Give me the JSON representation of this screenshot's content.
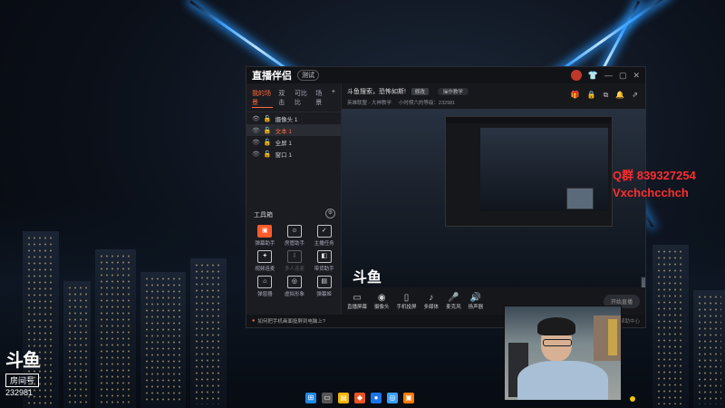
{
  "colors": {
    "accent": "#ff6a3d",
    "beam": "#3aa0ff",
    "overlay_text": "#ff2d2d"
  },
  "wallpaper": {
    "logo_mark": "斗鱼",
    "room_label": "房间号",
    "room_number": "232981"
  },
  "app": {
    "brand": "直播伴侣",
    "badge": "测试",
    "titlebar_icons": [
      "avatar",
      "shirt-icon",
      "minus-icon",
      "square-icon",
      "close-icon"
    ],
    "left_tabs": [
      "我的场景",
      "双击",
      "可比比",
      "场景"
    ],
    "left_tabs_plus": "+",
    "scenes": [
      {
        "name": "摄像头 1",
        "selected": false
      },
      {
        "name": "文本 1",
        "selected": true
      },
      {
        "name": "全屏 1",
        "selected": false
      },
      {
        "name": "窗口 1",
        "selected": false
      }
    ],
    "tools_title": "工具箱",
    "tools": [
      {
        "label": "弹幕助手",
        "glyph": "▣",
        "hot": true
      },
      {
        "label": "房管助手",
        "glyph": "☺",
        "hot": false
      },
      {
        "label": "主播任务",
        "glyph": "✓",
        "hot": false
      },
      {
        "label": "视频连麦",
        "glyph": "✦",
        "hot": false
      },
      {
        "label": "多人连麦",
        "glyph": "⇩",
        "hot": false,
        "dim": true
      },
      {
        "label": "带货助手",
        "glyph": "◧",
        "hot": false
      },
      {
        "label": "弹窗器",
        "glyph": "⌂",
        "hot": false
      },
      {
        "label": "虚拟形象",
        "glyph": "◎",
        "hot": false
      },
      {
        "label": "弹幕姬",
        "glyph": "▤",
        "hot": false
      }
    ],
    "room_title": "斗鱼搜索，恐怖如斯!",
    "edit_chip": "修改",
    "category_chip": "操作教学",
    "info_row2": [
      "英雄联盟 - 大神教学",
      "小时榜六的等级：232981"
    ],
    "bottom_buttons": [
      {
        "label": "直播屏幕",
        "glyph": "▭"
      },
      {
        "label": "摄像头",
        "glyph": "◉"
      },
      {
        "label": "手机投屏",
        "glyph": "▯"
      },
      {
        "label": "多媒体",
        "glyph": "♪"
      },
      {
        "label": "麦克风",
        "glyph": "🎤",
        "mic": true
      },
      {
        "label": "扬声器",
        "glyph": "🔊"
      }
    ],
    "start_button": "开始直播",
    "status_text": "如何把手机画面投屏到电脑上?",
    "status_right": "帮助中心"
  },
  "overlay": {
    "qq_line": "Q群 839327254",
    "wechat_line": "Vxchchcchch"
  },
  "taskbar_icons": [
    "windows-icon",
    "taskview-icon",
    "folder-icon",
    "app1-icon",
    "app2-icon",
    "browser-icon",
    "douyu-icon"
  ]
}
